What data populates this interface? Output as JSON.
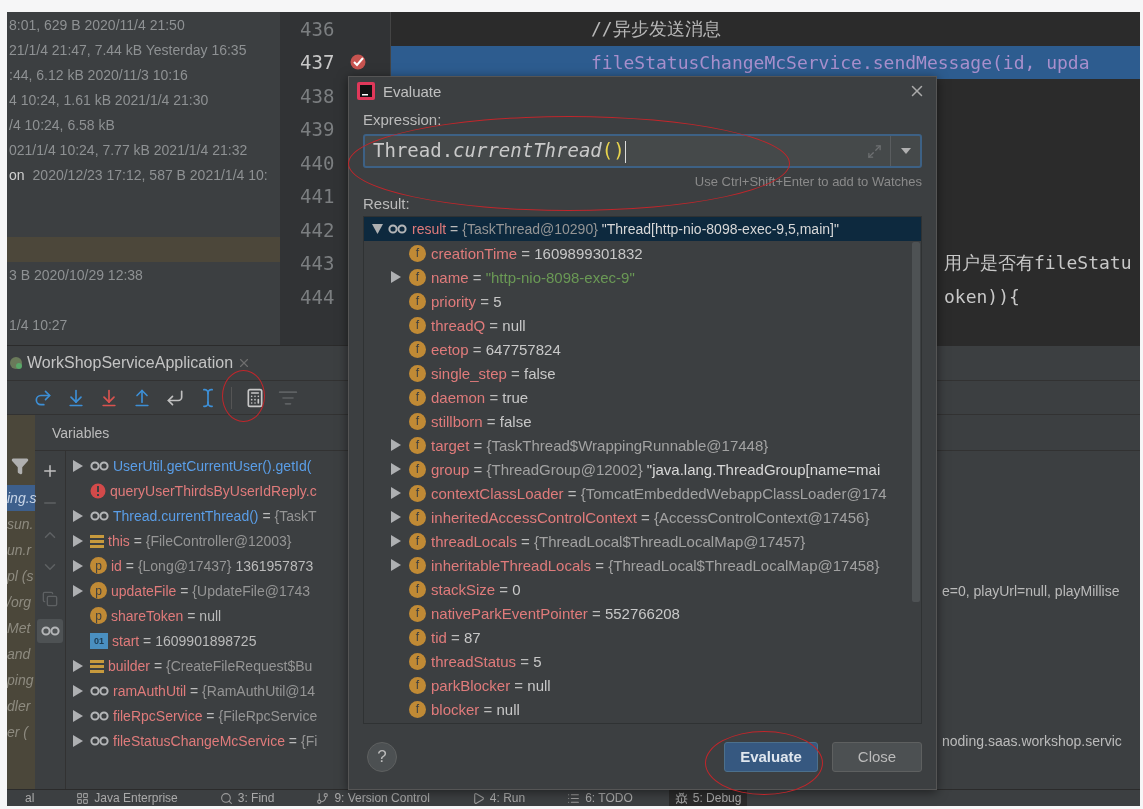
{
  "file_panel": {
    "rows": [
      {
        "kind": "file",
        "meta": "8:01, 629 B 2020/11/4 21:50"
      },
      {
        "kind": "file",
        "meta": "21/1/4 21:47, 7.44 kB Yesterday 16:35"
      },
      {
        "kind": "file",
        "meta": ":44, 6.12 kB 2020/11/3 10:16"
      },
      {
        "kind": "file",
        "meta": "4 10:24, 1.61 kB 2021/1/4 21:30"
      },
      {
        "kind": "file",
        "meta": "/4 10:24, 6.58 kB"
      },
      {
        "kind": "file",
        "meta": "021/1/4 10:24, 7.77 kB 2021/1/4 21:32"
      },
      {
        "kind": "file",
        "name": "on",
        "meta": "2020/12/23 17:12, 587 B 2021/1/4 10:"
      },
      {
        "kind": "blank"
      },
      {
        "kind": "blank"
      },
      {
        "kind": "highlight"
      },
      {
        "kind": "file",
        "meta": "3 B 2020/10/29 12:38"
      },
      {
        "kind": "blank"
      },
      {
        "kind": "file",
        "meta": "1/4 10:27"
      }
    ]
  },
  "editor": {
    "lines": [
      {
        "number": "436",
        "kind": "comment",
        "text": "//异步发送消息",
        "selected": false,
        "breakpoint": false
      },
      {
        "number": "437",
        "kind": "code",
        "text": "fileStatusChangeMcService.sendMessage(id, upda",
        "selected": true,
        "breakpoint": true
      },
      {
        "number": "438",
        "selected": false,
        "breakpoint": false
      },
      {
        "number": "439",
        "selected": false,
        "breakpoint": false
      },
      {
        "number": "440",
        "selected": false,
        "breakpoint": false
      },
      {
        "number": "441",
        "selected": false,
        "breakpoint": false
      },
      {
        "number": "442",
        "selected": false,
        "breakpoint": false
      },
      {
        "number": "443",
        "kind": "tail",
        "text": "用户是否有fileStatu",
        "selected": false,
        "breakpoint": false
      },
      {
        "number": "444",
        "kind": "tail",
        "text": "oken)){",
        "selected": false,
        "breakpoint": false
      }
    ]
  },
  "debug": {
    "title": "WorkShopServiceApplication",
    "variables_header": "Variables",
    "show_watches": true,
    "frames": [
      {
        "text": "ing.s",
        "selected": true
      },
      {
        "text": "sun.",
        "selected": false
      },
      {
        "text": "un.r",
        "selected": false
      },
      {
        "text": "pl (s",
        "selected": false
      },
      {
        "text": "/org",
        "selected": false
      },
      {
        "text": "Met",
        "selected": false
      },
      {
        "text": "and",
        "selected": false
      },
      {
        "text": "ping",
        "selected": false
      },
      {
        "text": "dler",
        "selected": false
      },
      {
        "text": "er (",
        "selected": false
      }
    ],
    "variables": [
      {
        "kind": "watch",
        "expression": true,
        "expandable": true,
        "name": "UserUtil.getCurrentUser().getId("
      },
      {
        "kind": "error",
        "expression": false,
        "expandable": false,
        "name": "queryUserThirdsByUserIdReply.c"
      },
      {
        "kind": "watch",
        "expression": true,
        "expandable": true,
        "name": "Thread.currentThread()",
        "sep": "=",
        "object": "{TaskT"
      },
      {
        "kind": "object",
        "expression": false,
        "expandable": true,
        "name": "this",
        "sep": "=",
        "object": "{FileController@12003}"
      },
      {
        "kind": "badge",
        "badge": "p",
        "expression": false,
        "expandable": true,
        "name": "id",
        "sep": "=",
        "object": "{Long@17437}",
        "value": "1361957873"
      },
      {
        "kind": "badge",
        "badge": "p",
        "expression": false,
        "expandable": true,
        "name": "updateFile",
        "sep": "=",
        "object": "{UpdateFile@1743",
        "tail": "e=0, playUrl=null, playMillise"
      },
      {
        "kind": "badge",
        "badge": "p",
        "expression": false,
        "expandable": false,
        "name": "shareToken",
        "sep": "=",
        "value": "null"
      },
      {
        "kind": "primitive",
        "badge": "01",
        "expression": false,
        "expandable": false,
        "name": "start",
        "sep": "=",
        "value": "1609901898725"
      },
      {
        "kind": "object",
        "expression": false,
        "expandable": true,
        "name": "builder",
        "sep": "=",
        "object": "{CreateFileRequest$Bu"
      },
      {
        "kind": "watch",
        "expression": false,
        "expandable": true,
        "name": "ramAuthUtil",
        "sep": "=",
        "object": "{RamAuthUtil@14"
      },
      {
        "kind": "watch",
        "expression": false,
        "expandable": true,
        "name": "fileRpcService",
        "sep": "=",
        "object": "{FileRpcService"
      },
      {
        "kind": "watch",
        "expression": false,
        "expandable": true,
        "name": "fileStatusChangeMcService",
        "sep": "=",
        "object": "{Fi",
        "tail": "noding.saas.workshop.servic"
      }
    ]
  },
  "evaluate_dialog": {
    "title": "Evaluate",
    "expression_label": "Expression:",
    "expression": [
      {
        "kind": "qualifier",
        "text": "Thread."
      },
      {
        "kind": "method",
        "text": "currentThread"
      },
      {
        "kind": "call",
        "text": "()"
      }
    ],
    "hint": "Use Ctrl+Shift+Enter to add to Watches",
    "result_label": "Result:",
    "result": {
      "name": "result",
      "sep": "=",
      "object": "{TaskThread@10290}",
      "value": "\"Thread[http-nio-8098-exec-9,5,main]\"",
      "expanded": true,
      "selected": true,
      "children": [
        {
          "badge": "f",
          "expandable": false,
          "name": "creationTime",
          "sep": "=",
          "kind": "number",
          "value": "1609899301832"
        },
        {
          "badge": "f",
          "expandable": true,
          "name": "name",
          "sep": "=",
          "kind": "string",
          "value": "\"http-nio-8098-exec-9\""
        },
        {
          "badge": "f",
          "expandable": false,
          "name": "priority",
          "sep": "=",
          "kind": "number",
          "value": "5"
        },
        {
          "badge": "f",
          "expandable": false,
          "name": "threadQ",
          "sep": "=",
          "kind": "number",
          "value": "null"
        },
        {
          "badge": "f",
          "expandable": false,
          "name": "eetop",
          "sep": "=",
          "kind": "number",
          "value": "647757824"
        },
        {
          "badge": "f",
          "expandable": false,
          "name": "single_step",
          "sep": "=",
          "kind": "number",
          "value": "false"
        },
        {
          "badge": "f",
          "expandable": false,
          "name": "daemon",
          "sep": "=",
          "kind": "number",
          "value": "true"
        },
        {
          "badge": "f",
          "expandable": false,
          "name": "stillborn",
          "sep": "=",
          "kind": "number",
          "value": "false"
        },
        {
          "badge": "f",
          "expandable": true,
          "name": "target",
          "sep": "=",
          "kind": "object",
          "value": "{TaskThread$WrappingRunnable@17448}"
        },
        {
          "badge": "f",
          "expandable": true,
          "name": "group",
          "sep": "=",
          "kind": "object",
          "value": "{ThreadGroup@12002}",
          "extra": "\"java.lang.ThreadGroup[name=mai"
        },
        {
          "badge": "f",
          "expandable": true,
          "name": "contextClassLoader",
          "sep": "=",
          "kind": "object",
          "value": "{TomcatEmbeddedWebappClassLoader@174"
        },
        {
          "badge": "f",
          "expandable": true,
          "name": "inheritedAccessControlContext",
          "sep": "=",
          "kind": "object",
          "value": "{AccessControlContext@17456}"
        },
        {
          "badge": "f",
          "expandable": true,
          "name": "threadLocals",
          "sep": "=",
          "kind": "object",
          "value": "{ThreadLocal$ThreadLocalMap@17457}"
        },
        {
          "badge": "f",
          "expandable": true,
          "name": "inheritableThreadLocals",
          "sep": "=",
          "kind": "object",
          "value": "{ThreadLocal$ThreadLocalMap@17458}"
        },
        {
          "badge": "f",
          "expandable": false,
          "name": "stackSize",
          "sep": "=",
          "kind": "number",
          "value": "0"
        },
        {
          "badge": "f",
          "expandable": false,
          "name": "nativeParkEventPointer",
          "sep": "=",
          "kind": "number",
          "value": "552766208"
        },
        {
          "badge": "f",
          "expandable": false,
          "name": "tid",
          "sep": "=",
          "kind": "number",
          "value": "87"
        },
        {
          "badge": "f",
          "expandable": false,
          "name": "threadStatus",
          "sep": "=",
          "kind": "number",
          "value": "5"
        },
        {
          "badge": "f",
          "expandable": false,
          "name": "parkBlocker",
          "sep": "=",
          "kind": "number",
          "value": "null"
        },
        {
          "badge": "f",
          "expandable": false,
          "name": "blocker",
          "sep": "=",
          "kind": "number",
          "value": "null"
        }
      ]
    },
    "help": "?",
    "buttons": [
      {
        "label": "Evaluate",
        "kind": "primary"
      },
      {
        "label": "Close",
        "kind": "secondary"
      }
    ]
  },
  "tool_bar": [
    {
      "kind": "plain",
      "label": "al",
      "selected": false
    },
    {
      "kind": "enterprise",
      "label": "Java Enterprise",
      "selected": false
    },
    {
      "kind": "find",
      "label": "3: Find",
      "selected": false
    },
    {
      "kind": "vcs",
      "label": "9: Version Control",
      "selected": false
    },
    {
      "kind": "run",
      "label": "4: Run",
      "selected": false
    },
    {
      "kind": "todo",
      "label": "6: TODO",
      "selected": false
    },
    {
      "kind": "debug",
      "label": "5: Debug",
      "selected": true
    }
  ]
}
